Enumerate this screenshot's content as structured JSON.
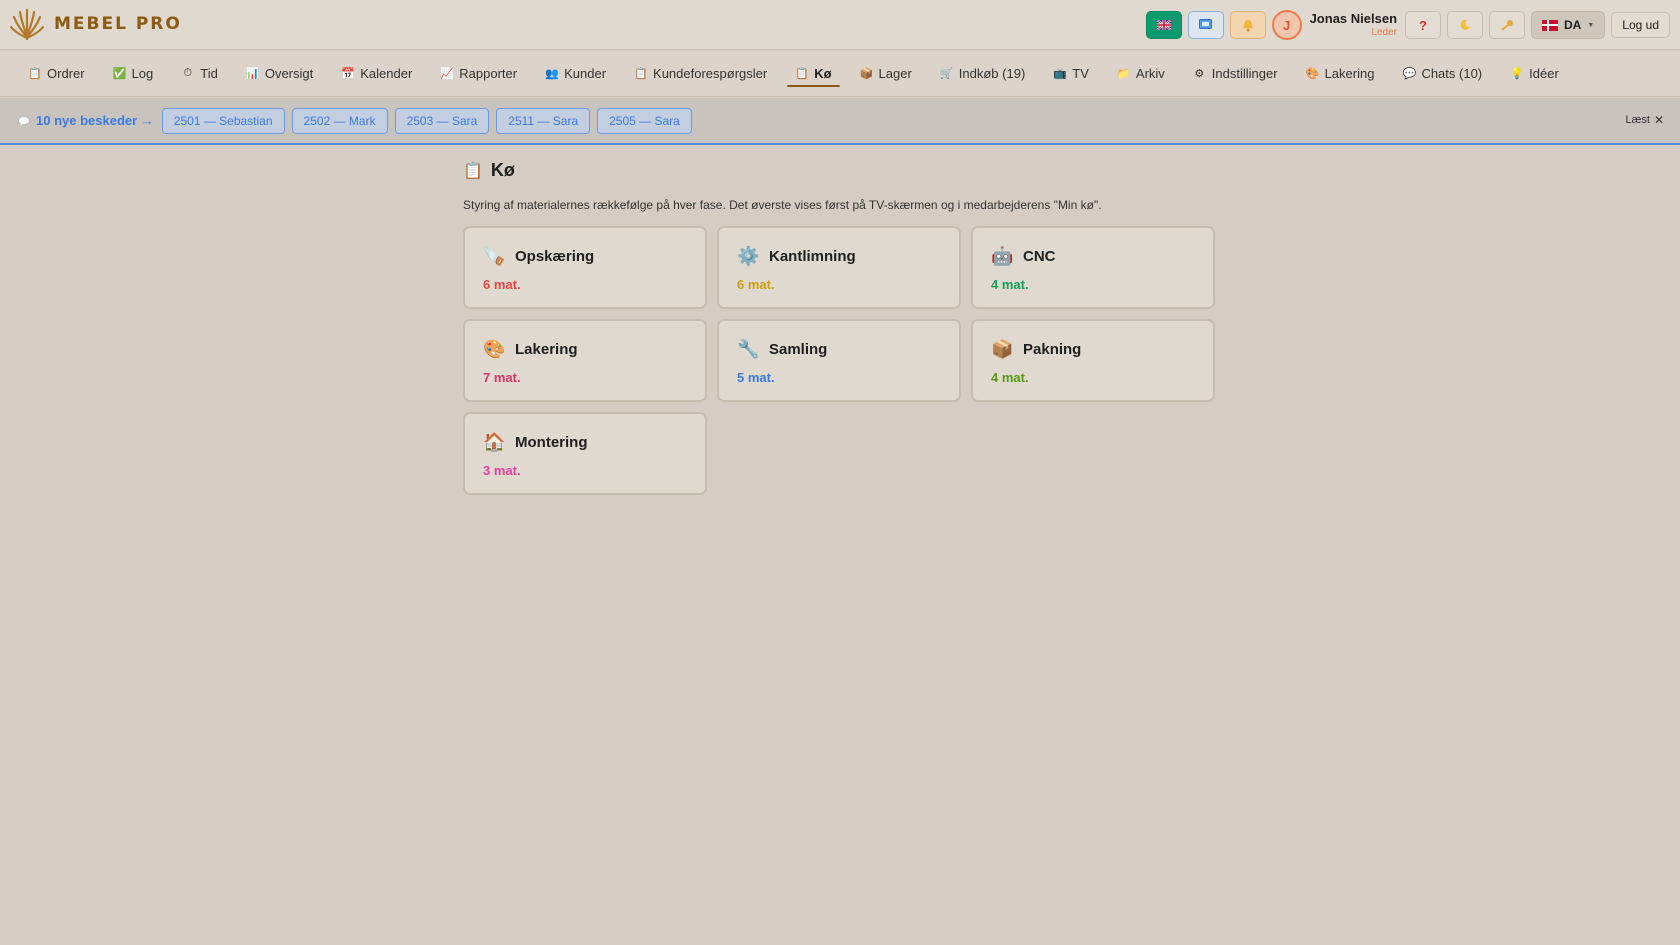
{
  "header": {
    "brand": "MEBEL PRO",
    "user_name": "Jonas Nielsen",
    "user_role": "Leder",
    "avatar_initial": "J",
    "help_icon": "?",
    "language": "DA",
    "logout_label": "Log ud"
  },
  "nav": {
    "items": [
      {
        "label": "Ordrer",
        "icon": "📋"
      },
      {
        "label": "Log",
        "icon": "✅"
      },
      {
        "label": "Tid",
        "icon": "⏱"
      },
      {
        "label": "Oversigt",
        "icon": "📊"
      },
      {
        "label": "Kalender",
        "icon": "📅"
      },
      {
        "label": "Rapporter",
        "icon": "📈"
      },
      {
        "label": "Kunder",
        "icon": "👥"
      },
      {
        "label": "Kundeforespørgsler",
        "icon": "📋"
      },
      {
        "label": "Kø",
        "icon": "📋"
      },
      {
        "label": "Lager",
        "icon": "📦"
      },
      {
        "label": "Indkøb (19)",
        "icon": "🛒"
      },
      {
        "label": "TV",
        "icon": "📺"
      },
      {
        "label": "Arkiv",
        "icon": "📁"
      },
      {
        "label": "Indstillinger",
        "icon": "⚙"
      },
      {
        "label": "Lakering",
        "icon": "🎨"
      },
      {
        "label": "Chats (10)",
        "icon": "💬"
      },
      {
        "label": "Idéer",
        "icon": "💡"
      }
    ],
    "active": "Kø"
  },
  "messages": {
    "count_label": "10 nye beskeder →",
    "chips": [
      "2501 — Sebastian",
      "2502 — Mark",
      "2503 — Sara",
      "2511 — Sara",
      "2505 — Sara"
    ],
    "read_label": "Læst"
  },
  "page": {
    "title": "Kø",
    "description": "Styring af materialernes rækkefølge på hver fase. Det øverste vises først på TV-skærmen og i medarbejderens \"Min kø\"."
  },
  "phases": [
    {
      "name": "Opskæring",
      "count": "6 mat.",
      "icon": "🪚",
      "color": "#e64545"
    },
    {
      "name": "Kantlimning",
      "count": "6 mat.",
      "icon": "⚙️",
      "color": "#c9a012"
    },
    {
      "name": "CNC",
      "count": "4 mat.",
      "icon": "🤖",
      "color": "#12a05a"
    },
    {
      "name": "Lakering",
      "count": "7 mat.",
      "icon": "🎨",
      "color": "#d6346a"
    },
    {
      "name": "Samling",
      "count": "5 mat.",
      "icon": "🔧",
      "color": "#3b7be0"
    },
    {
      "name": "Pakning",
      "count": "4 mat.",
      "icon": "📦",
      "color": "#5a9a12"
    },
    {
      "name": "Montering",
      "count": "3 mat.",
      "icon": "🏠",
      "color": "#e63fa8"
    }
  ]
}
